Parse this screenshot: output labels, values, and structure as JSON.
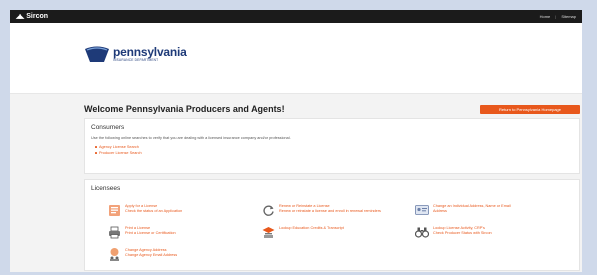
{
  "app": {
    "name": "Sircon",
    "top_links": [
      "Home",
      "Sitemap"
    ]
  },
  "header": {
    "logo_name": "pennsylvania",
    "logo_sub": "INSURANCE DEPARTMENT"
  },
  "main": {
    "welcome_title": "Welcome Pennsylvania Producers and Agents!",
    "cta_label": "Return to Pennsylvania Homepage",
    "consumers": {
      "title": "Consumers",
      "intro": "Use the following online searches to verify that you are dealing with a licensed insurance company and/or professional.",
      "links": [
        "Agency License Search",
        "Producer License Search"
      ]
    },
    "licensees": {
      "title": "Licensees",
      "tiles": [
        {
          "icon": "application-form-icon",
          "links": [
            "Apply for a License",
            "Check the status of an Application"
          ]
        },
        {
          "icon": "renew-refresh-icon",
          "links": [
            "Renew or Reinstate a License",
            "Renew or reinstate a license and enroll in renewal reminders"
          ]
        },
        {
          "icon": "id-card-icon",
          "links": [
            "Change an Individual Address, Name or Email",
            "Address"
          ]
        },
        {
          "icon": "printer-icon",
          "links": [
            "Print a License",
            "Print a License or Certification"
          ]
        },
        {
          "icon": "graduation-cap-icon",
          "links": [
            "Lookup Education Credits & Transcript"
          ]
        },
        {
          "icon": "binoculars-icon",
          "links": [
            "Lookup License Activity, CRP's",
            "Check Producer Status with Sircon"
          ]
        },
        {
          "icon": "agency-globe-icon",
          "links": [
            "Change Agency Address",
            "Change Agency Email Address"
          ]
        }
      ]
    }
  },
  "colors": {
    "accent": "#e8581c",
    "brand_blue": "#1e3a78",
    "topbar": "#1b1b1b",
    "page_bg": "#f3f3f3",
    "outer_bg": "#cfd9ea"
  }
}
